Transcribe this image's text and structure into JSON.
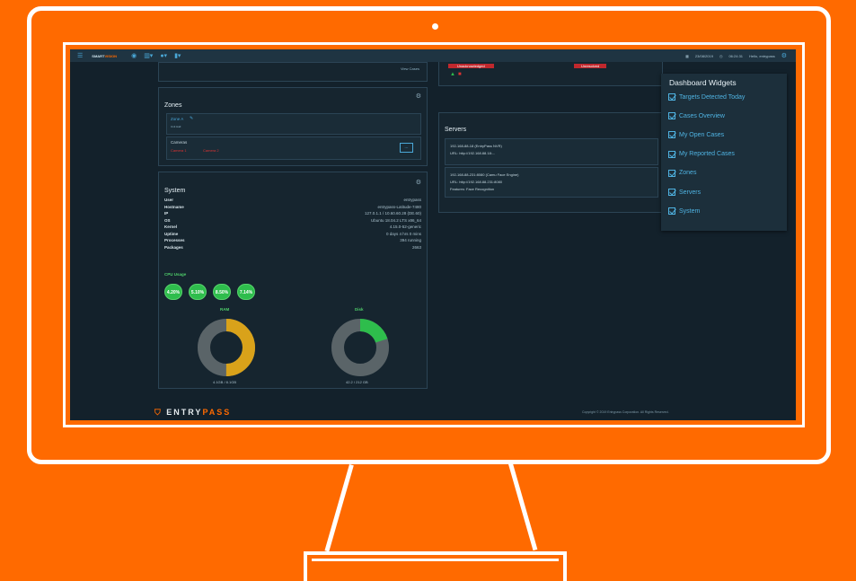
{
  "navbar": {
    "brand_a": "SMART",
    "brand_b": "VISION",
    "date": "23/08/2019",
    "time": "06:24:31",
    "user": "Hello, entrypass"
  },
  "left_top_fragment": {
    "text": "View Cases"
  },
  "zones": {
    "title": "Zones",
    "zone_name": "Zone A",
    "zone_sub": "Unit Hall",
    "cameras_label": "Cameras",
    "camera_1": "Camera 1",
    "camera_2": "Camera 2",
    "more_button": "..."
  },
  "system": {
    "title": "System",
    "rows": [
      {
        "label": "User",
        "value": "entrypass"
      },
      {
        "label": "Hostname",
        "value": "entrypass-Latitude-7480"
      },
      {
        "label": "IP",
        "value": "127.0.1.1 / 10.60.60.28 (DE.60)"
      },
      {
        "label": "OS",
        "value": "Ubuntu 18.04.2 LTS x86_64"
      },
      {
        "label": "Kernel",
        "value": "4.15.0-52-generic"
      },
      {
        "label": "Uptime",
        "value": "0 days 4 hrs 0 mins"
      },
      {
        "label": "Processes",
        "value": "394 running"
      },
      {
        "label": "Packages",
        "value": "2663"
      }
    ],
    "cpu_label": "CPU Usage",
    "cpu": [
      "4.20%",
      "5.10%",
      "8.50%",
      "7.14%"
    ],
    "ram_label": "RAM",
    "ram_value": "4.1GB / 8.1GB",
    "ram_fraction": 0.5,
    "disk_label": "Disk",
    "disk_value": "42.2 / 212 GB",
    "disk_fraction": 0.2
  },
  "cases_fragment": {
    "badge_1": "Unacknowledged",
    "badge_2": "Unresolved"
  },
  "servers": {
    "title": "Servers",
    "items": [
      {
        "line1": "192-168-88-18 (EntryPass NVR)",
        "line2": "URL: http://192.168.88.18:..."
      },
      {
        "line1": "192-168-88-231:8080 (Camu Face Engine)",
        "line2": "URL: http://192.168.88.231:8080",
        "line3": "Features: Face Recognition"
      }
    ]
  },
  "widgets": {
    "title": "Dashboard Widgets",
    "items": [
      "Targets Detected Today",
      "Cases Overview",
      "My Open Cases",
      "My Reported Cases",
      "Zones",
      "Servers",
      "System"
    ]
  },
  "footer": {
    "logo_a": "ENTRY",
    "logo_b": "PASS",
    "copyright": "Copyright © 2019 Entrypass Corporation. All Rights Reserved."
  },
  "colors": {
    "accent": "#ff6a00",
    "screen_bg": "#13212b",
    "ram": "#d9a21a",
    "disk": "#2ebd4c",
    "ring_bg": "#5a6468"
  }
}
